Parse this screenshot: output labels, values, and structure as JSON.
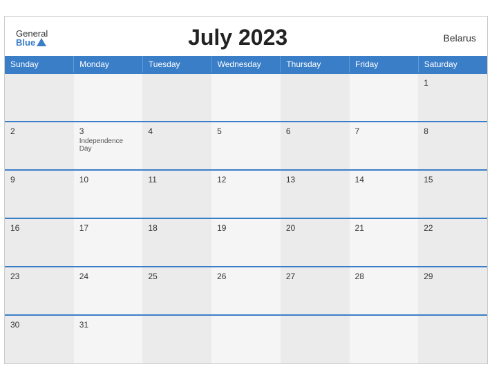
{
  "header": {
    "title": "July 2023",
    "country": "Belarus",
    "logo_general": "General",
    "logo_blue": "Blue"
  },
  "weekdays": [
    "Sunday",
    "Monday",
    "Tuesday",
    "Wednesday",
    "Thursday",
    "Friday",
    "Saturday"
  ],
  "weeks": [
    [
      {
        "day": "",
        "event": ""
      },
      {
        "day": "",
        "event": ""
      },
      {
        "day": "",
        "event": ""
      },
      {
        "day": "",
        "event": ""
      },
      {
        "day": "",
        "event": ""
      },
      {
        "day": "",
        "event": ""
      },
      {
        "day": "1",
        "event": ""
      }
    ],
    [
      {
        "day": "2",
        "event": ""
      },
      {
        "day": "3",
        "event": "Independence Day"
      },
      {
        "day": "4",
        "event": ""
      },
      {
        "day": "5",
        "event": ""
      },
      {
        "day": "6",
        "event": ""
      },
      {
        "day": "7",
        "event": ""
      },
      {
        "day": "8",
        "event": ""
      }
    ],
    [
      {
        "day": "9",
        "event": ""
      },
      {
        "day": "10",
        "event": ""
      },
      {
        "day": "11",
        "event": ""
      },
      {
        "day": "12",
        "event": ""
      },
      {
        "day": "13",
        "event": ""
      },
      {
        "day": "14",
        "event": ""
      },
      {
        "day": "15",
        "event": ""
      }
    ],
    [
      {
        "day": "16",
        "event": ""
      },
      {
        "day": "17",
        "event": ""
      },
      {
        "day": "18",
        "event": ""
      },
      {
        "day": "19",
        "event": ""
      },
      {
        "day": "20",
        "event": ""
      },
      {
        "day": "21",
        "event": ""
      },
      {
        "day": "22",
        "event": ""
      }
    ],
    [
      {
        "day": "23",
        "event": ""
      },
      {
        "day": "24",
        "event": ""
      },
      {
        "day": "25",
        "event": ""
      },
      {
        "day": "26",
        "event": ""
      },
      {
        "day": "27",
        "event": ""
      },
      {
        "day": "28",
        "event": ""
      },
      {
        "day": "29",
        "event": ""
      }
    ],
    [
      {
        "day": "30",
        "event": ""
      },
      {
        "day": "31",
        "event": ""
      },
      {
        "day": "",
        "event": ""
      },
      {
        "day": "",
        "event": ""
      },
      {
        "day": "",
        "event": ""
      },
      {
        "day": "",
        "event": ""
      },
      {
        "day": "",
        "event": ""
      }
    ]
  ]
}
